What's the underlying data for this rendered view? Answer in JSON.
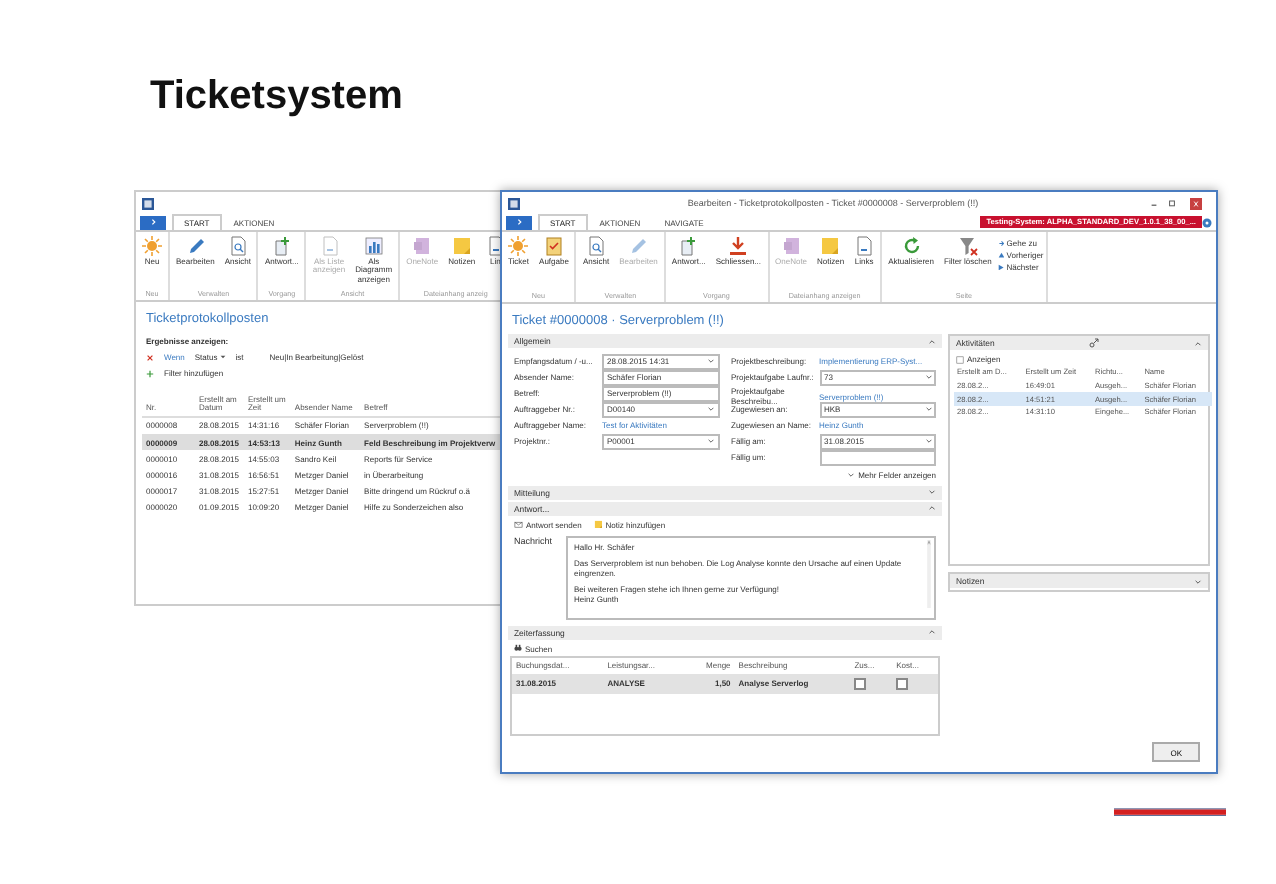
{
  "slide_title": "Ticketsystem",
  "list_window": {
    "tabs": [
      {
        "label": "START",
        "selected": true
      },
      {
        "label": "AKTIONEN",
        "selected": false
      }
    ],
    "groups": [
      {
        "label": "Neu",
        "buttons": [
          {
            "label": "Neu",
            "disabled": false
          }
        ]
      },
      {
        "label": "Verwalten",
        "buttons": [
          {
            "label": "Bearbeiten",
            "disabled": false
          },
          {
            "label": "Ansicht",
            "disabled": false
          }
        ]
      },
      {
        "label": "Vorgang",
        "buttons": [
          {
            "label": "Antwort...",
            "disabled": false
          }
        ]
      },
      {
        "label": "Ansicht",
        "buttons": [
          {
            "label": "Als Liste anzeigen",
            "disabled": true
          },
          {
            "label": "Als Diagramm anzeigen",
            "disabled": false
          }
        ]
      },
      {
        "label": "Dateianhang anzeig",
        "buttons": [
          {
            "label": "OneNote",
            "disabled": true
          },
          {
            "label": "Notizen",
            "disabled": false
          },
          {
            "label": "Lin",
            "disabled": false
          }
        ]
      }
    ],
    "page_title": "Ticketprotokollposten",
    "filter": {
      "heading": "Ergebnisse anzeigen:",
      "condition": "Wenn",
      "field": "Status",
      "operator": "ist",
      "value": "Neu|In Bearbeitung|Gelöst",
      "add_label": "Filter hinzufügen"
    },
    "columns": [
      "Nr.",
      "Erstellt am Datum",
      "Erstellt um Zeit",
      "Absender Name",
      "Betreff"
    ],
    "rows": [
      {
        "cells": [
          "0000008",
          "28.08.2015",
          "14:31:16",
          "Schäfer Florian",
          "Serverproblem (!!)"
        ],
        "selected": false
      },
      {
        "cells": [
          "0000009",
          "28.08.2015",
          "14:53:13",
          "Heinz Gunth",
          "Feld Beschreibung im Projektverw"
        ],
        "selected": true
      },
      {
        "cells": [
          "0000010",
          "28.08.2015",
          "14:55:03",
          "Sandro Keil",
          "Reports für Service"
        ],
        "selected": false
      },
      {
        "cells": [
          "0000016",
          "31.08.2015",
          "16:56:51",
          "Metzger Daniel",
          "in Überarbeitung"
        ],
        "selected": false
      },
      {
        "cells": [
          "0000017",
          "31.08.2015",
          "15:27:51",
          "Metzger Daniel",
          "Bitte dringend um Rückruf o.ä"
        ],
        "selected": false
      },
      {
        "cells": [
          "0000020",
          "01.09.2015",
          "10:09:20",
          "Metzger Daniel",
          "Hilfe zu Sonderzeichen also"
        ],
        "selected": false
      }
    ]
  },
  "ticket_window": {
    "title": "Bearbeiten - Ticketprotokollposten - Ticket #0000008 - Serverproblem (!!)",
    "tabs": [
      {
        "label": "START",
        "selected": true
      },
      {
        "label": "AKTIONEN",
        "selected": false
      },
      {
        "label": "NAVIGATE",
        "selected": false
      }
    ],
    "badge": "Testing-System: ALPHA_STANDARD_DEV_1.0.1_38_00_...",
    "groups": [
      {
        "label": "Neu",
        "buttons": [
          {
            "label": "Ticket",
            "disabled": false
          },
          {
            "label": "Aufgabe",
            "disabled": false
          }
        ]
      },
      {
        "label": "Verwalten",
        "buttons": [
          {
            "label": "Ansicht",
            "disabled": false
          },
          {
            "label": "Bearbeiten",
            "disabled": true
          }
        ]
      },
      {
        "label": "Vorgang",
        "buttons": [
          {
            "label": "Antwort...",
            "disabled": false
          },
          {
            "label": "Schliessen...",
            "disabled": false
          }
        ]
      },
      {
        "label": "Dateianhang anzeigen",
        "buttons": [
          {
            "label": "OneNote",
            "disabled": true
          },
          {
            "label": "Notizen",
            "disabled": false
          },
          {
            "label": "Links",
            "disabled": false
          }
        ]
      },
      {
        "label": "Seite",
        "buttons": [
          {
            "label": "Aktualisieren",
            "disabled": false
          },
          {
            "label": "Filter löschen",
            "disabled": false
          }
        ],
        "small_buttons": [
          "Gehe zu",
          "Vorheriger",
          "Nächster"
        ]
      }
    ],
    "page_title": "Ticket #0000008 · Serverproblem (!!)",
    "general": {
      "label": "Allgemein",
      "expanded": true,
      "left_fields": [
        {
          "label": "Empfangsdatum / -u...",
          "value": "28.08.2015 14:31",
          "kind": "dropdown"
        },
        {
          "label": "Absender Name:",
          "value": "Schäfer Florian",
          "kind": "box"
        },
        {
          "label": "Betreff:",
          "value": "Serverproblem (!!)",
          "kind": "box"
        },
        {
          "label": "Auftraggeber Nr.:",
          "value": "D00140",
          "kind": "dropdown"
        },
        {
          "label": "Auftraggeber Name:",
          "value": "Test for Aktivitäten",
          "kind": "link"
        },
        {
          "label": "Projektnr.:",
          "value": "P00001",
          "kind": "dropdown"
        }
      ],
      "right_fields": [
        {
          "label": "Projektbeschreibung:",
          "value": "Implementierung ERP-Syst...",
          "kind": "link"
        },
        {
          "label": "Projektaufgabe Laufnr.:",
          "value": "73",
          "kind": "dropdown"
        },
        {
          "label": "Projektaufgabe Beschreibu...",
          "value": "Serverproblem (!!)",
          "kind": "link"
        },
        {
          "label": "Zugewiesen an:",
          "value": "HKB",
          "kind": "dropdown"
        },
        {
          "label": "Zugewiesen an Name:",
          "value": "Heinz Gunth",
          "kind": "link"
        },
        {
          "label": "Fällig am:",
          "value": "31.08.2015",
          "kind": "dropdown"
        },
        {
          "label": "Fällig um:",
          "kind": "box"
        }
      ],
      "more_fields": "Mehr Felder anzeigen"
    },
    "message_section": {
      "label": "Mitteilung",
      "expanded": false
    },
    "reply": {
      "label": "Antwort...",
      "expanded": true,
      "actions": [
        "Antwort senden",
        "Notiz hinzufügen"
      ],
      "message_label": "Nachricht",
      "paragraphs": [
        [
          "Hallo Hr. Schäfer"
        ],
        [
          "Das Serverproblem ist nun behoben. Die Log Analyse konnte den Ursache auf einen Update eingrenzen."
        ],
        [
          "Bei weiteren Fragen stehe ich Ihnen gerne zur Verfügung!",
          "Heinz Gunth"
        ]
      ]
    },
    "time_tracking": {
      "label": "Zeiterfassung",
      "expanded": true,
      "search": "Suchen",
      "columns": [
        "Buchungsdat...",
        "Leistungsar...",
        "Menge",
        "Beschreibung",
        "Zus...",
        "Kost..."
      ],
      "rows": [
        {
          "date": "31.08.2015",
          "type": "ANALYSE",
          "quantity": "1,50",
          "description": "Analyse Serverlog",
          "extra": false,
          "cost": false,
          "selected": true
        }
      ]
    },
    "activities": {
      "label": "Aktivitäten",
      "expanded": true,
      "show": "Anzeigen",
      "columns": [
        "Erstellt am D...",
        "Erstellt um Zeit",
        "Richtu...",
        "Name"
      ],
      "rows": [
        {
          "cells": [
            "28.08.2...",
            "16:49:01",
            "Ausgeh...",
            "Schäfer Florian"
          ],
          "selected": false
        },
        {
          "cells": [
            "28.08.2...",
            "14:51:21",
            "Ausgeh...",
            "Schäfer Florian"
          ],
          "selected": true
        },
        {
          "cells": [
            "28.08.2...",
            "14:31:10",
            "Eingehe...",
            "Schäfer Florian"
          ],
          "selected": false
        }
      ]
    },
    "notes": {
      "label": "Notizen",
      "expanded": false
    },
    "ok_button": "OK"
  }
}
